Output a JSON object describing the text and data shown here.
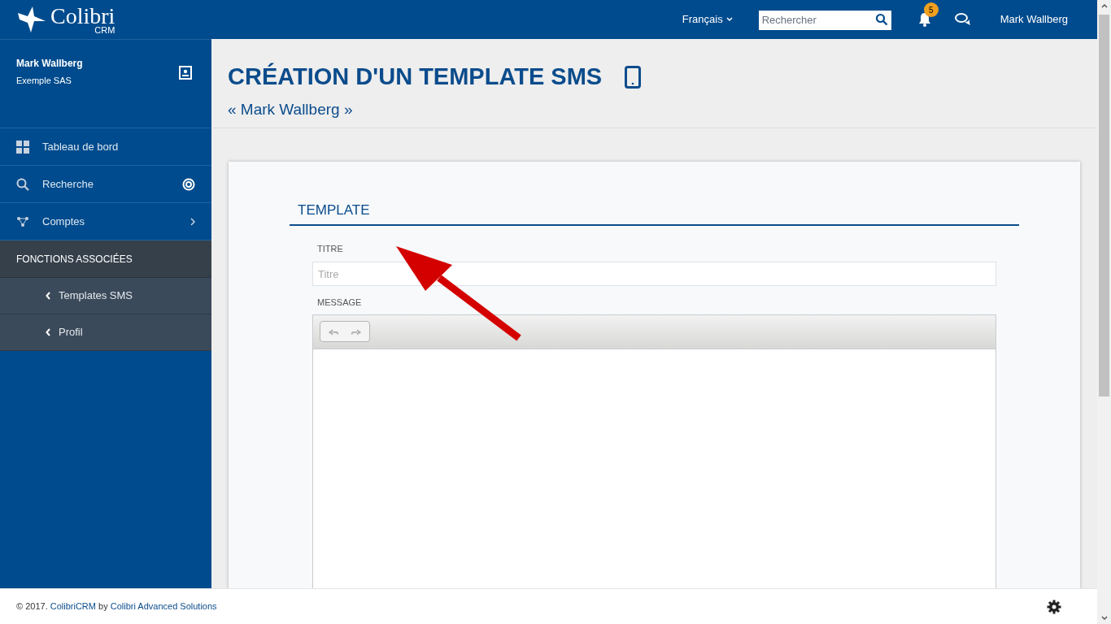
{
  "topbar": {
    "logo": "Colibri",
    "logo_sub": "CRM",
    "language": "Français",
    "search": {
      "placeholder": "Rechercher"
    },
    "notifications": "5",
    "user": "Mark Wallberg"
  },
  "sidebar": {
    "user": {
      "name": "Mark Wallberg",
      "company": "Exemple SAS"
    },
    "items": [
      {
        "label": "Tableau de bord"
      },
      {
        "label": "Recherche"
      },
      {
        "label": "Comptes"
      }
    ],
    "section": "FONCTIONS ASSOCIÉES",
    "sub_items": [
      {
        "label": "Templates SMS"
      },
      {
        "label": "Profil"
      }
    ]
  },
  "page": {
    "title": "CRÉATION D'UN TEMPLATE SMS",
    "subtitle": "« Mark Wallberg »"
  },
  "form": {
    "section": "TEMPLATE",
    "title_label": "TITRE",
    "title_field": {
      "placeholder": "Titre"
    },
    "message_label": "MESSAGE",
    "toolbar": [
      {
        "kind": "undo",
        "disabled": true
      },
      {
        "kind": "redo",
        "disabled": true
      }
    ]
  },
  "footer": {
    "prefix": "© 2017.",
    "link": "ColibriCRM",
    "middle": "by",
    "company_link": "Colibri Advanced Solutions"
  }
}
